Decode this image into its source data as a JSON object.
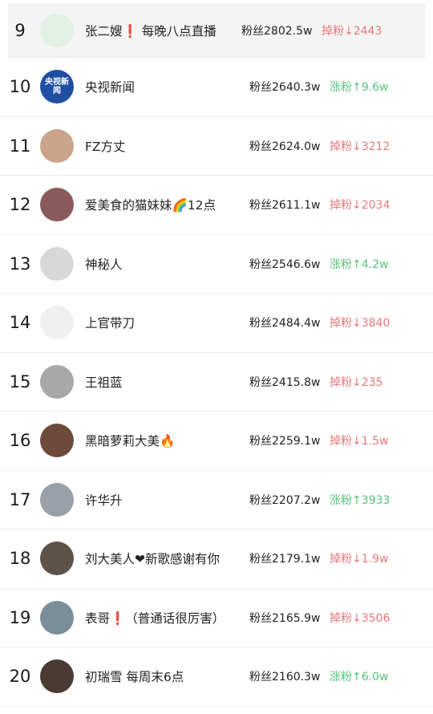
{
  "rows": [
    {
      "rank": "9",
      "name": "张二嫂❗ 每晚八点直播",
      "fans": "粉丝2802.5w",
      "change": "掉粉↓2443",
      "dir": "down",
      "avatar_icon": "cartoon-girl-avatar",
      "avatar_bg": "#e3f0e4"
    },
    {
      "rank": "10",
      "name": "央视新闻",
      "fans": "粉丝2640.3w",
      "change": "涨粉↑9.6w",
      "dir": "up",
      "avatar_icon": "cctv-news-logo-avatar",
      "avatar_bg": "#1f4fa3",
      "avatar_text": "央视新闻"
    },
    {
      "rank": "11",
      "name": "FZ方丈",
      "fans": "粉丝2624.0w",
      "change": "掉粉↓3212",
      "dir": "down",
      "avatar_icon": "user-photo-avatar",
      "avatar_bg": "#c9a48a"
    },
    {
      "rank": "12",
      "name": "爱美食的猫妹妹🌈12点",
      "fans": "粉丝2611.1w",
      "change": "掉粉↓2034",
      "dir": "down",
      "avatar_icon": "user-photo-avatar",
      "avatar_bg": "#8a5a5a"
    },
    {
      "rank": "13",
      "name": "神秘人",
      "fans": "粉丝2546.6w",
      "change": "涨粉↑4.2w",
      "dir": "up",
      "avatar_icon": "user-photo-avatar",
      "avatar_bg": "#d8d8d8"
    },
    {
      "rank": "14",
      "name": "上官带刀",
      "fans": "粉丝2484.4w",
      "change": "掉粉↓3840",
      "dir": "down",
      "avatar_icon": "cartoon-avatar",
      "avatar_bg": "#f0f0f0"
    },
    {
      "rank": "15",
      "name": "王祖蓝",
      "fans": "粉丝2415.8w",
      "change": "掉粉↓235",
      "dir": "down",
      "avatar_icon": "user-photo-avatar",
      "avatar_bg": "#a8a8a8"
    },
    {
      "rank": "16",
      "name": "黑暗萝莉大美🔥",
      "fans": "粉丝2259.1w",
      "change": "掉粉↓1.5w",
      "dir": "down",
      "avatar_icon": "user-photo-avatar",
      "avatar_bg": "#6e4a3c"
    },
    {
      "rank": "17",
      "name": "许华升",
      "fans": "粉丝2207.2w",
      "change": "涨粉↑3933",
      "dir": "up",
      "avatar_icon": "user-photo-avatar",
      "avatar_bg": "#9aa0a8"
    },
    {
      "rank": "18",
      "name": "刘大美人❤新歌感谢有你",
      "fans": "粉丝2179.1w",
      "change": "掉粉↓1.9w",
      "dir": "down",
      "avatar_icon": "user-photo-avatar",
      "avatar_bg": "#5c5248"
    },
    {
      "rank": "19",
      "name": "表哥❗（普通话很厉害）",
      "fans": "粉丝2165.9w",
      "change": "掉粉↓3506",
      "dir": "down",
      "avatar_icon": "user-photo-avatar",
      "avatar_bg": "#7a8e9a"
    },
    {
      "rank": "20",
      "name": "初瑞雪 每周末6点",
      "fans": "粉丝2160.3w",
      "change": "涨粉↑6.0w",
      "dir": "up",
      "avatar_icon": "user-photo-avatar",
      "avatar_bg": "#4a3a32"
    }
  ]
}
